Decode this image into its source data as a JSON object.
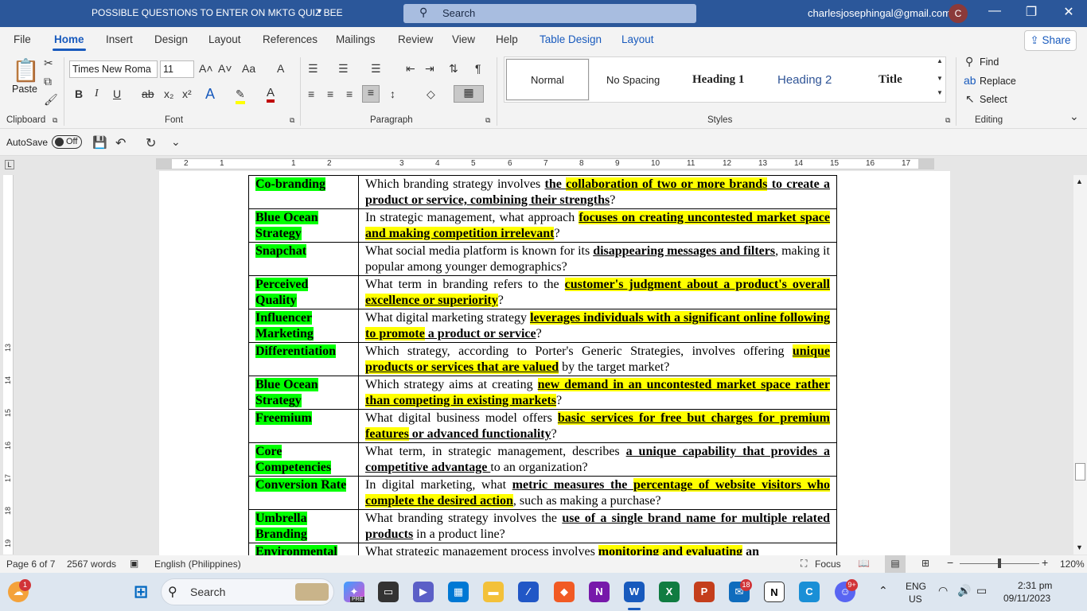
{
  "titlebar": {
    "doc_title": "POSSIBLE QUESTIONS TO ENTER ON MKTG QUIZ BEE",
    "search": "Search",
    "user": "charlesjosephingal@gmail.com",
    "avatar": "C"
  },
  "tabs": [
    "File",
    "Home",
    "Insert",
    "Design",
    "Layout",
    "References",
    "Mailings",
    "Review",
    "View",
    "Help",
    "Table Design",
    "Layout"
  ],
  "share": "Share",
  "ribbon": {
    "paste": "Paste",
    "font_name": "Times New Roma",
    "font_size": "11",
    "groups": {
      "clipboard": "Clipboard",
      "font": "Font",
      "paragraph": "Paragraph",
      "styles": "Styles",
      "editing": "Editing"
    },
    "styles": [
      "Normal",
      "No Spacing",
      "Heading 1",
      "Heading 2",
      "Title"
    ],
    "editing": {
      "find": "Find",
      "replace": "Replace",
      "select": "Select"
    }
  },
  "qat": {
    "autosave": "AutoSave",
    "toggle": "Off"
  },
  "ruler": {
    "h": [
      "2",
      "1",
      "1",
      "2",
      "3",
      "4",
      "5",
      "6",
      "7",
      "8",
      "9",
      "10",
      "11",
      "12",
      "13",
      "14",
      "15",
      "16",
      "17",
      "18"
    ],
    "v": [
      "13",
      "14",
      "15",
      "16",
      "17",
      "18",
      "19"
    ]
  },
  "table": [
    {
      "term": "Co-branding",
      "q": [
        [
          "Which branding strategy involves ",
          ""
        ],
        [
          "the ",
          "b"
        ],
        [
          "collaboration of two or more brands",
          "bh"
        ],
        [
          " to create a product or service, combining their strengths",
          "b"
        ],
        [
          "?",
          ""
        ]
      ]
    },
    {
      "term": "Blue Ocean Strategy",
      "q": [
        [
          "In strategic management, what approach ",
          ""
        ],
        [
          "focuses on creating uncontested market space and making competition irrelevant",
          "bh"
        ],
        [
          "?",
          ""
        ]
      ]
    },
    {
      "term": "Snapchat",
      "q": [
        [
          "What social media platform is known for its ",
          ""
        ],
        [
          "disappearing messages and filters",
          "b"
        ],
        [
          ", making it popular among younger demographics?",
          ""
        ]
      ]
    },
    {
      "term": "Perceived Quality",
      "q": [
        [
          "What term in branding refers to the ",
          ""
        ],
        [
          "customer's judgment about a product's overall excellence or superiority",
          "bh"
        ],
        [
          "?",
          ""
        ]
      ]
    },
    {
      "term": "Influencer Marketing",
      "q": [
        [
          "What digital marketing strategy ",
          ""
        ],
        [
          "leverages individuals with a significant online following to promote",
          "bh"
        ],
        [
          " a product or service",
          "b"
        ],
        [
          "?",
          ""
        ]
      ]
    },
    {
      "term": "Differentiation",
      "q": [
        [
          "Which strategy, according to Porter's Generic Strategies, involves offering ",
          ""
        ],
        [
          "unique products or services that are valued",
          "bh"
        ],
        [
          " by the target market?",
          ""
        ]
      ]
    },
    {
      "term": "Blue Ocean Strategy",
      "q": [
        [
          "Which strategy aims at creating ",
          ""
        ],
        [
          "new demand in an uncontested market space rather than competing in existing markets",
          "bh"
        ],
        [
          "?",
          ""
        ]
      ]
    },
    {
      "term": "Freemium",
      "q": [
        [
          "What digital business model offers ",
          ""
        ],
        [
          "basic services for free but charges for premium features",
          "bh"
        ],
        [
          " or advanced functionality",
          "b"
        ],
        [
          "?",
          ""
        ]
      ]
    },
    {
      "term": "Core Competencies",
      "q": [
        [
          "What term, in strategic management, describes ",
          ""
        ],
        [
          "a unique capability that provides a competitive advantage ",
          "b"
        ],
        [
          "to an organization?",
          ""
        ]
      ]
    },
    {
      "term": "Conversion Rate",
      "q": [
        [
          "In digital marketing, what ",
          ""
        ],
        [
          "metric measures the ",
          "b"
        ],
        [
          "percentage of website visitors who complete the desired action",
          "bh"
        ],
        [
          ", such as making a purchase?",
          ""
        ]
      ]
    },
    {
      "term": "Umbrella Branding",
      "q": [
        [
          "What branding strategy involves the ",
          ""
        ],
        [
          "use of a single brand name for multiple related products",
          "b"
        ],
        [
          " in a product line?",
          ""
        ]
      ]
    },
    {
      "term": "Environmental",
      "q": [
        [
          "What strategic management process involves ",
          ""
        ],
        [
          "monitoring and evaluating",
          "bh"
        ],
        [
          " ",
          ""
        ],
        [
          "an",
          "b"
        ]
      ]
    }
  ],
  "status": {
    "page": "Page 6 of 7",
    "words": "2567 words",
    "language": "English (Philippines)",
    "focus": "Focus",
    "zoom": "120%"
  },
  "taskbar": {
    "search": "Search",
    "lang1": "ENG",
    "lang2": "US",
    "time": "2:31 pm",
    "date": "09/11/2023",
    "badge_weather": "1",
    "badge_pre": "PRE",
    "badge_mail": "18",
    "badge_discord": "9+"
  },
  "colors": {
    "word_blue": "#2b579a",
    "accent": "#185abd",
    "highlight_yellow": "#ffff00",
    "highlight_green": "#00ff00"
  }
}
